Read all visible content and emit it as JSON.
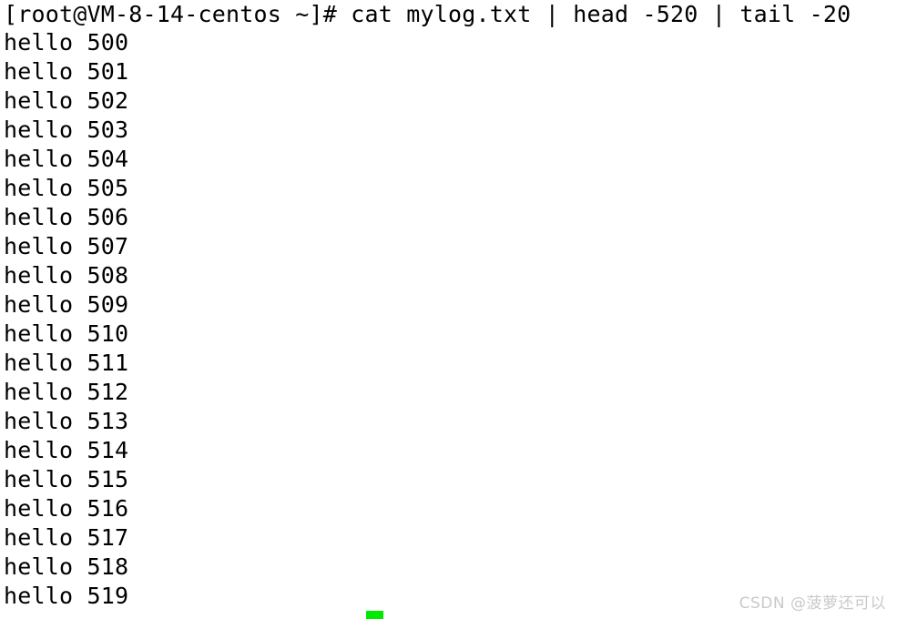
{
  "terminal": {
    "title": "cat mylog.txt | head -520 | tail -20",
    "background_color": "#ffffff",
    "foreground_color": "#000000",
    "prompt": {
      "full_text": "[root@VM-8-14-centos ~]# cat mylog.txt | head -520 | tail -20",
      "user": "root",
      "host": "VM-8-14-centos",
      "cwd": "~",
      "symbol": "#",
      "command": "cat mylog.txt | head -520 | tail -20"
    },
    "output_lines": [
      "hello 500",
      "hello 501",
      "hello 502",
      "hello 503",
      "hello 504",
      "hello 505",
      "hello 506",
      "hello 507",
      "hello 508",
      "hello 509",
      "hello 510",
      "hello 511",
      "hello 512",
      "hello 513",
      "hello 514",
      "hello 515",
      "hello 516",
      "hello 517",
      "hello 518",
      "hello 519"
    ],
    "cursor": {
      "visible": true,
      "color": "#00ea00",
      "shape": "underscore-block"
    }
  },
  "watermark": {
    "text": "CSDN @菠萝还可以",
    "color": "#c9c9c9"
  }
}
